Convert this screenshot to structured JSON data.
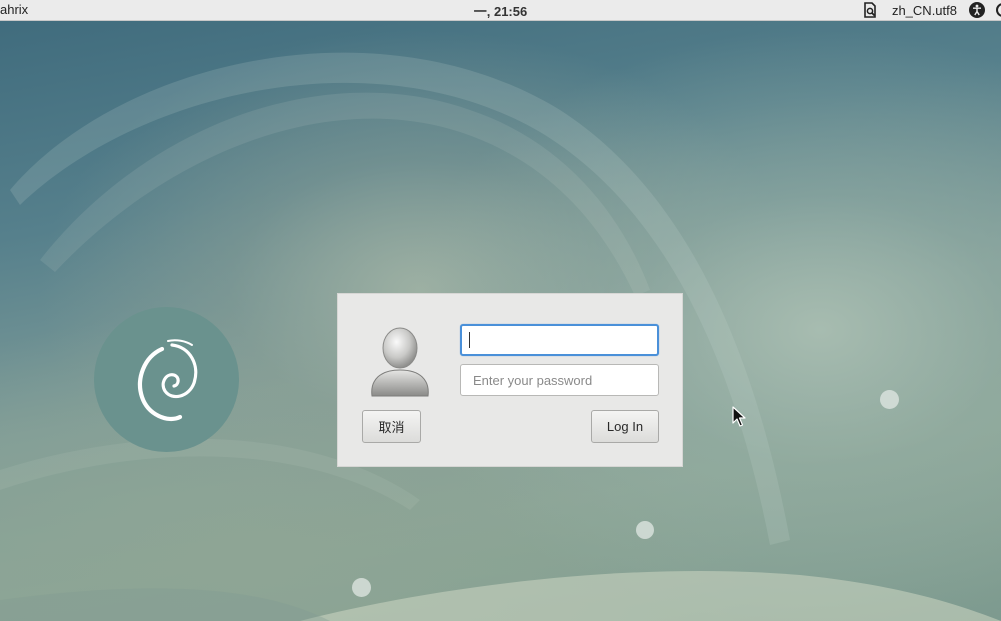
{
  "top_bar": {
    "left_text": "ahrix",
    "clock": "一, 21:56",
    "locale": "zh_CN.utf8",
    "icons": [
      "document-search-icon",
      "accessibility-icon",
      "power-icon"
    ]
  },
  "login": {
    "username_value": "",
    "password_placeholder": "Enter your password",
    "cancel_label": "取消",
    "login_label": "Log In"
  },
  "colors": {
    "focus_accent": "#4a90d9",
    "dialog_bg": "#e8e8e7",
    "panel_bg": "#ebebeb",
    "logo_badge": "#6a928e"
  }
}
